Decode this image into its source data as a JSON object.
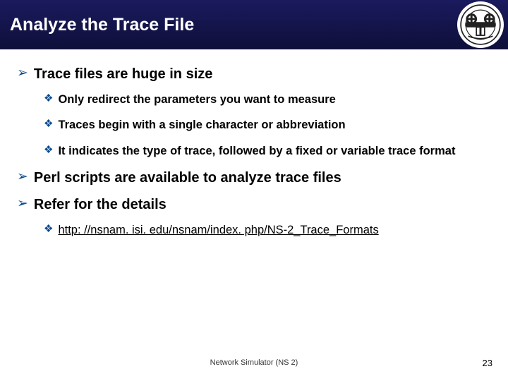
{
  "header": {
    "title": "Analyze the Trace File"
  },
  "bullets": [
    {
      "text": "Trace files are huge in size",
      "sub": [
        {
          "text": "Only redirect the parameters you want to measure"
        },
        {
          "text": "Traces begin with a single character or abbreviation"
        },
        {
          "text": "It indicates the type of trace, followed by a fixed or variable trace format"
        }
      ]
    },
    {
      "text": "Perl scripts are available to analyze trace files",
      "sub": []
    },
    {
      "text": "Refer for the details",
      "sub": [
        {
          "text": "http: //nsnam. isi. edu/nsnam/index. php/NS-2_Trace_Formats",
          "link": true
        }
      ]
    }
  ],
  "footer": {
    "center": "Network Simulator (NS 2)",
    "page": "23"
  }
}
